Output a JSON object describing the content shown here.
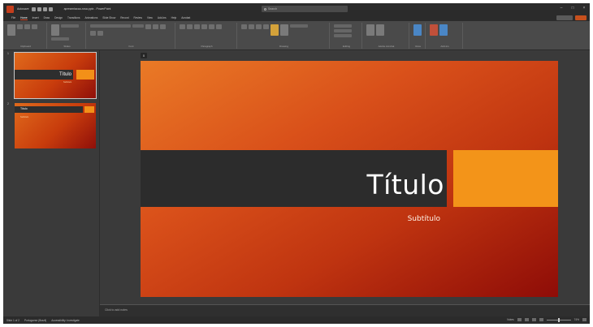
{
  "app": {
    "name": "Autosave",
    "filename": "apresentacao-rosa.pptx - PowerPoint"
  },
  "search": {
    "placeholder": "Search"
  },
  "tabs": [
    {
      "label": "File"
    },
    {
      "label": "Home"
    },
    {
      "label": "Insert"
    },
    {
      "label": "Draw"
    },
    {
      "label": "Design"
    },
    {
      "label": "Transitions"
    },
    {
      "label": "Animations"
    },
    {
      "label": "Slide Show"
    },
    {
      "label": "Record"
    },
    {
      "label": "Review"
    },
    {
      "label": "View"
    },
    {
      "label": "Add-ins"
    },
    {
      "label": "Help"
    },
    {
      "label": "Acrobat"
    }
  ],
  "ribbon": {
    "groups": [
      {
        "name": "Clipboard"
      },
      {
        "name": "Slides"
      },
      {
        "name": "Font"
      },
      {
        "name": "Paragraph"
      },
      {
        "name": "Drawing"
      },
      {
        "name": "Editing"
      },
      {
        "name": "Adobe Acrobat"
      },
      {
        "name": "Voice"
      },
      {
        "name": "Add-ins"
      }
    ]
  },
  "thumbnails": [
    {
      "number": "1",
      "title": "Título",
      "subtitle": "Subtítulo"
    },
    {
      "number": "2",
      "title": "Título",
      "subtitle": "Subtítulo"
    }
  ],
  "slide": {
    "title": "Título",
    "subtitle": "Subtítulo",
    "section_marker": "0",
    "colors": {
      "gradient_start": "#ea7a26",
      "gradient_end": "#8e0c07",
      "band": "#2c2c2c",
      "accent": "#f39419"
    }
  },
  "notes": {
    "placeholder": "Click to add notes"
  },
  "status": {
    "slide_counter": "Slide 1 of 2",
    "language": "Portuguese (Brazil)",
    "accessibility": "Accessibility: Investigate",
    "notes_label": "Notes",
    "zoom": "74%"
  }
}
